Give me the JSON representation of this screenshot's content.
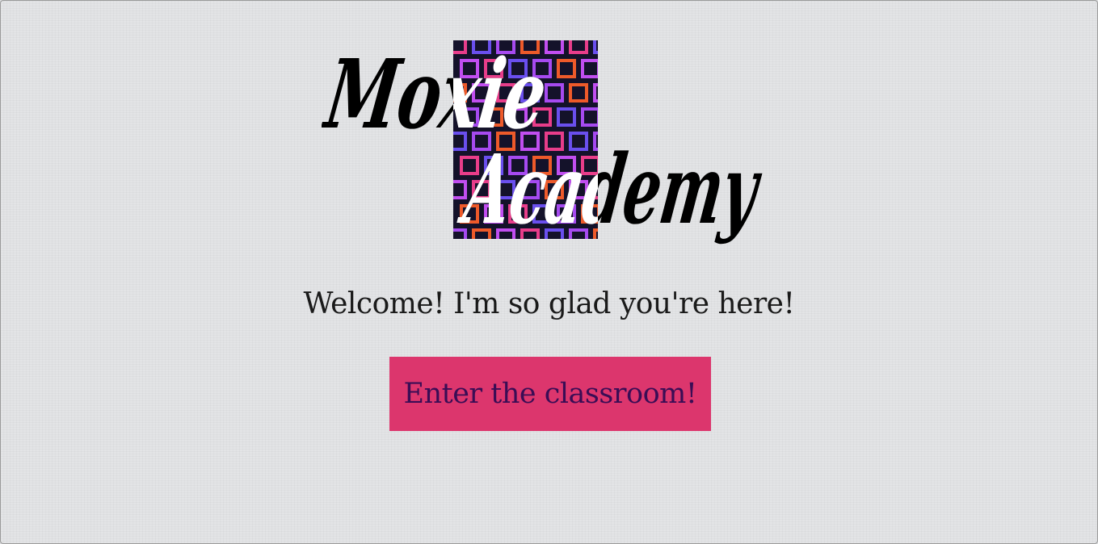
{
  "logo": {
    "line1": "Moxie",
    "line2": "Academy",
    "pattern_colors": {
      "background": "#14122a",
      "squares": [
        "#e83d8a",
        "#ee5a2a",
        "#6a4fee",
        "#c14ef0",
        "#a64af0"
      ]
    }
  },
  "welcome": {
    "message": "Welcome! I'm so glad you're here!"
  },
  "cta": {
    "label": "Enter the classroom!",
    "background": "#dc366d",
    "text_color": "#3a0d55"
  }
}
